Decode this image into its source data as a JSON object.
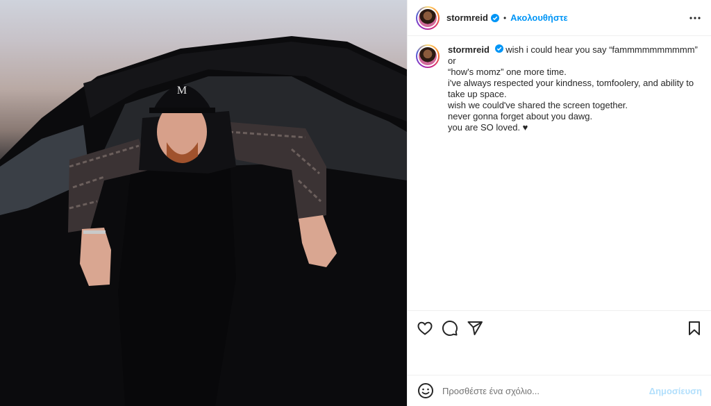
{
  "post": {
    "username": "stormreid",
    "follow_label": "Ακολουθήστε",
    "separator": "•",
    "verified_icon": "verified-badge-icon",
    "colors": {
      "accent": "#0095f6",
      "post_disabled": "#b2dffc",
      "text": "#262626",
      "placeholder": "#737373"
    }
  },
  "caption": {
    "username": "stormreid",
    "lines": [
      "wish i could hear you say “fammmmmmmmmm” or",
      "“how's momz” one more time.",
      "i've always respected your kindness, tomfoolery, and ability to",
      "take up space.",
      "wish we could've shared the screen together.",
      "never gonna forget about you dawg.",
      "you are SO loved. ♥"
    ]
  },
  "actions": {
    "icons": [
      "heart-icon",
      "comment-icon",
      "share-icon",
      "bookmark-icon"
    ]
  },
  "comment": {
    "placeholder": "Προσθέστε ένα σχόλιο...",
    "value": "",
    "post_label": "Δημοσίευση",
    "emoji_icon": "emoji-icon"
  }
}
